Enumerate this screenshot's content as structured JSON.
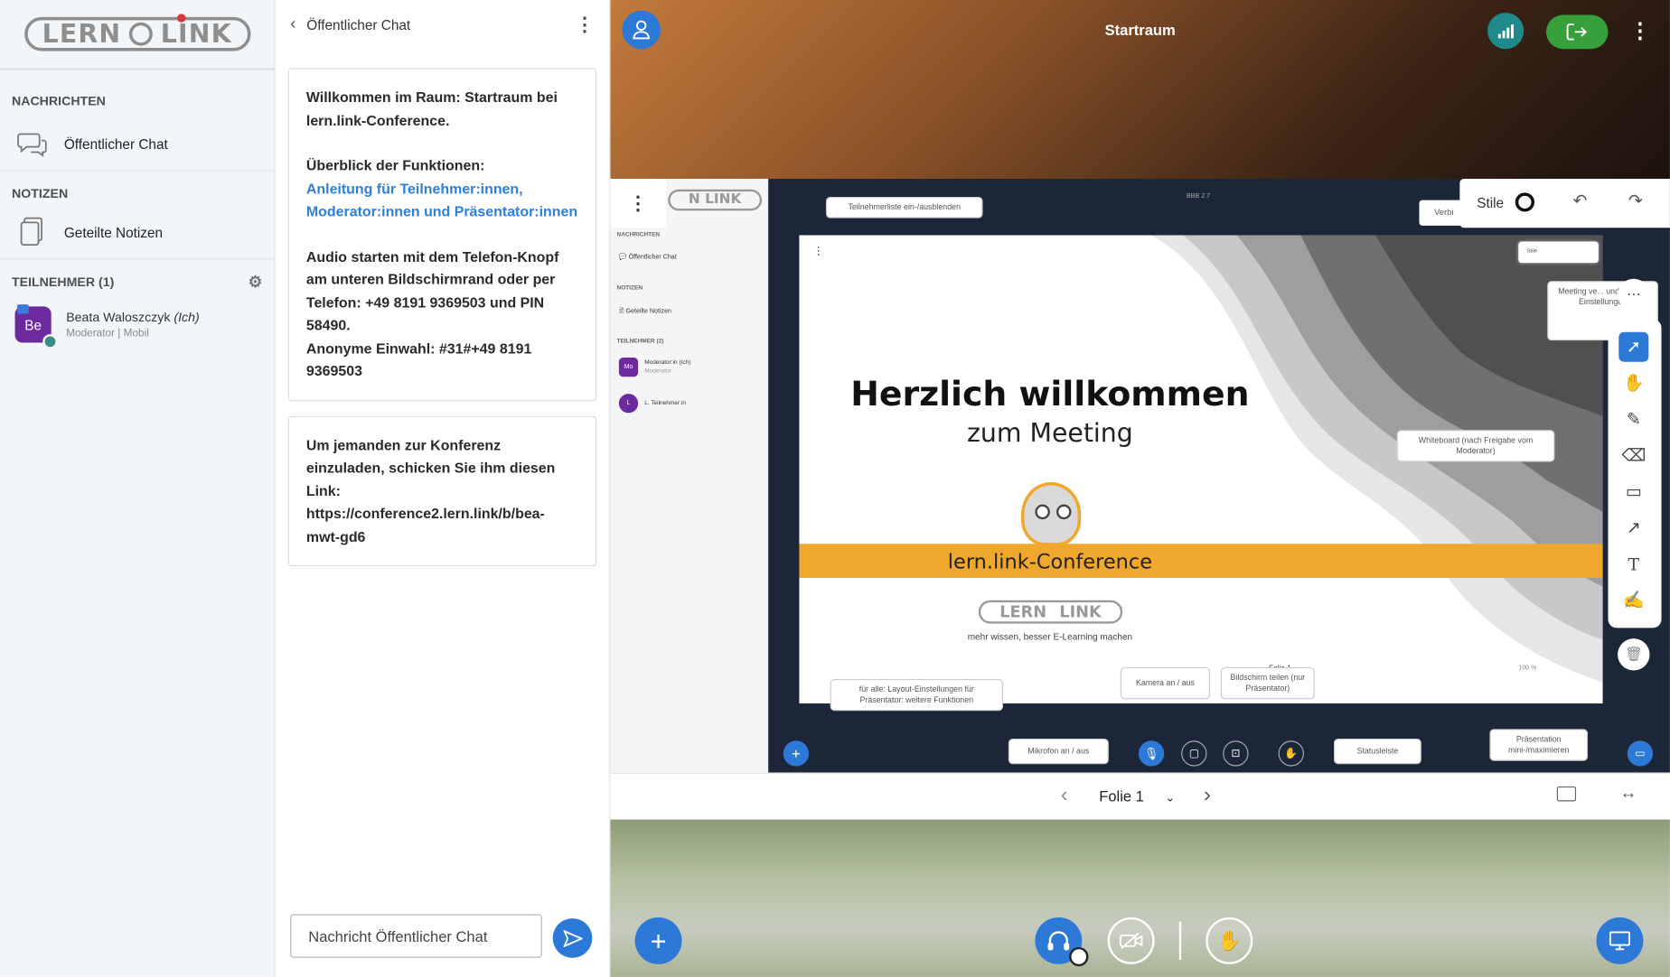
{
  "sidebar": {
    "logo_text_left": "LERN",
    "logo_text_right": "LINK",
    "messages_title": "NACHRICHTEN",
    "public_chat": "Öffentlicher Chat",
    "notes_title": "NOTIZEN",
    "shared_notes": "Geteilte Notizen",
    "participants_title": "TEILNEHMER (1)",
    "user": {
      "initials": "Be",
      "name": "Beata Waloszczyk",
      "me": "(Ich)",
      "role": "Moderator | Mobil"
    }
  },
  "chat": {
    "title": "Öffentlicher Chat",
    "welcome": {
      "line1": "Willkommen im Raum: Startraum bei lern.link-Conference.",
      "line2": "Überblick der Funktionen:",
      "link": "Anleitung für Teilnehmer:innen, Moderator:innen und Präsentator:innen",
      "line3": "Audio starten mit dem Telefon-Knopf am unteren Bildschirmrand oder per Telefon: +49 8191 9369503 und PIN 58490.",
      "line4": "Anonyme Einwahl: #31#+49 8191 9369503"
    },
    "invite": "Um jemanden zur Konferenz einzuladen, schicken Sie ihm diesen Link: https://conference2.lern.link/b/bea-mwt-gd6",
    "input_placeholder": "Nachricht Öffentlicher Chat"
  },
  "header": {
    "room_title": "Startraum"
  },
  "presentation": {
    "slide_title": "Herzlich willkommen",
    "slide_subtitle": "zum Meeting",
    "slide_banner": "lern.link-Conference",
    "slide_logo_left": "LERN",
    "slide_logo_right": "LINK",
    "slide_tagline": "mehr wissen, besser E-Learning machen",
    "inner_bbb": "BBB 2.7",
    "inner_verbi": "Verbi",
    "inner_logo": "N LINK",
    "inner_sidebar": {
      "messages": "NACHRICHTEN",
      "public_chat": "Öffentlicher Chat",
      "notes": "NOTIZEN",
      "shared_notes": "Geteilte Notizen",
      "participants": "TEILNEHMER (2)",
      "user1_initials": "Mo",
      "user1_name": "Moderator:in (Ich)",
      "user1_role": "Moderator",
      "user2_initials": "L",
      "user2_name": "L. Teilnehmer:in"
    },
    "inner_stile": "Stile",
    "inner_folie": "Folie 1",
    "inner_zoom": "100 %",
    "tooltips": {
      "participant_list": "Teilnehmerliste ein-/ausblenden",
      "meeting_settings": "Meeting ve... und weitere Einstellungen",
      "whiteboard": "Whiteboard (nach Freigabe vom Moderator)",
      "layout": "für alle: Layout-Einstellungen für Präsentator: weitere Funktionen",
      "camera": "Kamera an / aus",
      "screen": "Bildschirm teilen (nur Präsentator)",
      "mic": "Mikrofon an / aus",
      "status": "Statusleiste",
      "presentation": "Präsentation mini-/maximieren"
    },
    "slide_nav": {
      "label": "Folie 1"
    }
  },
  "whiteboard_toolbar": {
    "stile": "Stile"
  },
  "colors": {
    "accent": "#2d79d8",
    "avatar": "#6c2a9e",
    "connection": "#1f8a8c",
    "leave": "#38a03a"
  }
}
